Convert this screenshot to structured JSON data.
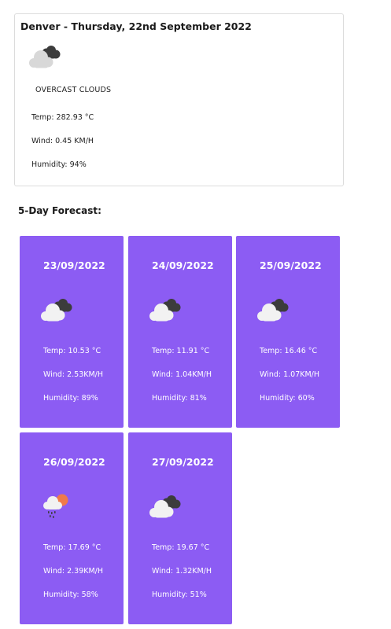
{
  "current": {
    "title": "Denver - Thursday, 22nd September 2022",
    "icon": "overcast-clouds-icon",
    "description": "OVERCAST CLOUDS",
    "temp": "Temp: 282.93 °C",
    "wind": "Wind: 0.45 KM/H",
    "humidity": "Humidity: 94%"
  },
  "forecast": {
    "heading": "5-Day Forecast:",
    "days": [
      {
        "date": "23/09/2022",
        "icon": "overcast-clouds-icon",
        "temp": "Temp: 10.53 °C",
        "wind": "Wind: 2.53KM/H",
        "humidity": "Humidity: 89%"
      },
      {
        "date": "24/09/2022",
        "icon": "overcast-clouds-icon",
        "temp": "Temp: 11.91 °C",
        "wind": "Wind: 1.04KM/H",
        "humidity": "Humidity: 81%"
      },
      {
        "date": "25/09/2022",
        "icon": "overcast-clouds-icon",
        "temp": "Temp: 16.46 °C",
        "wind": "Wind: 1.07KM/H",
        "humidity": "Humidity: 60%"
      },
      {
        "date": "26/09/2022",
        "icon": "rain-sun-icon",
        "temp": "Temp: 17.69 °C",
        "wind": "Wind: 2.39KM/H",
        "humidity": "Humidity: 58%"
      },
      {
        "date": "27/09/2022",
        "icon": "overcast-clouds-icon",
        "temp": "Temp: 19.67 °C",
        "wind": "Wind: 1.32KM/H",
        "humidity": "Humidity: 51%"
      }
    ]
  },
  "colors": {
    "card_purple": "#8c5cf3",
    "card_border": "#dcdcdc",
    "text_dark": "#1a1a1a",
    "text_white": "#ffffff"
  }
}
